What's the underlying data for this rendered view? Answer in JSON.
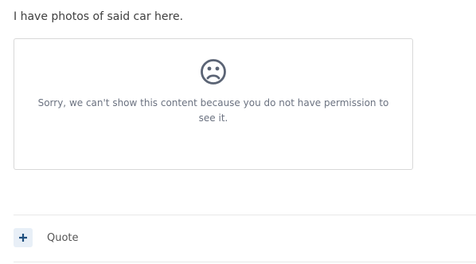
{
  "post": {
    "text": "I have photos of said car here."
  },
  "restricted": {
    "icon": "sad-face-icon",
    "message": "Sorry, we can't show this content because you do not have permission to see it."
  },
  "actions": {
    "quote_label": "Quote",
    "plus_icon": "plus-icon"
  },
  "colors": {
    "icon": "#5b6475",
    "message": "#6b7280",
    "button_bg": "#e8eff7",
    "plus": "#1f4f7f",
    "border": "#d8d8d8"
  }
}
